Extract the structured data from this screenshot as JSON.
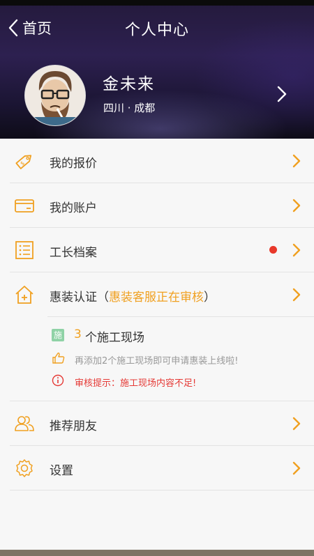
{
  "header": {
    "back_label": "首页",
    "title": "个人中心"
  },
  "profile": {
    "name": "金未来",
    "location": "四川 · 成都"
  },
  "menu": {
    "quote": {
      "label": "我的报价",
      "icon": "price-tag-icon"
    },
    "account": {
      "label": "我的账户",
      "icon": "card-icon"
    },
    "foreman": {
      "label": "工长档案",
      "icon": "list-icon",
      "has_badge": true
    },
    "cert": {
      "label_prefix": "惠装认证（",
      "status": "惠装客服正在审核",
      "label_suffix": "）",
      "icon": "house-plus-icon",
      "site_badge": "施",
      "site_count": "3",
      "site_text": "个施工现场",
      "tip": "再添加2个施工现场即可申请惠装上线啦!",
      "warning": "审核提示：施工现场内容不足!"
    },
    "recommend": {
      "label": "推荐朋友",
      "icon": "friends-icon"
    },
    "settings": {
      "label": "设置",
      "icon": "gear-icon"
    }
  },
  "colors": {
    "accent": "#f0a020",
    "warning": "#e53935",
    "badge": "#8fd2a6"
  }
}
